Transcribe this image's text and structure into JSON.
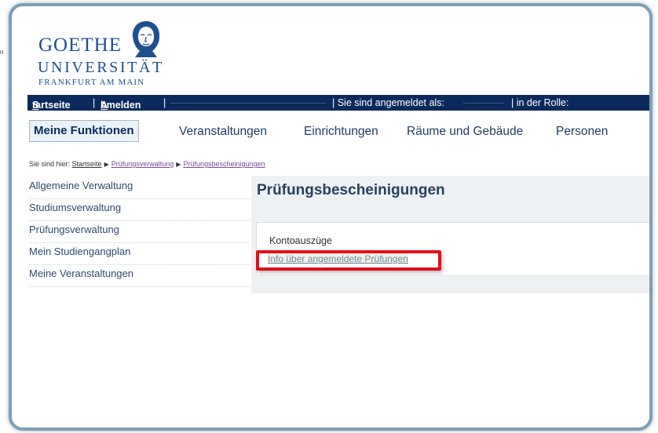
{
  "sidemark": "n",
  "logo": {
    "line1": "GOETHE",
    "line2": "UNIVERSITÄT",
    "line3": "FRANKFURT AM MAIN"
  },
  "topbar": {
    "startseite_S": "S",
    "startseite_rest": "tartseite",
    "sep1": "|",
    "abmelden_A": "A",
    "abmelden_rest": "bmelden",
    "sep2": "|",
    "logged_in": "| Sie sind angemeldet als:",
    "role": "| in der Rolle:"
  },
  "nav": {
    "active": "Meine Funktionen",
    "items": [
      "Veranstaltungen",
      "Einrichtungen",
      "Räume und Gebäude",
      "Personen"
    ]
  },
  "breadcrumb": {
    "prefix": "Sie sind hier:",
    "items": [
      "Startseite",
      "Prüfungsverwaltung",
      "Prüfungsbescheinigungen"
    ]
  },
  "sidebar": {
    "items": [
      "Allgemeine Verwaltung",
      "Studiumsverwaltung",
      "Prüfungsverwaltung",
      "Mein Studiengangplan",
      "Meine Veranstaltungen"
    ]
  },
  "main": {
    "title": "Prüfungsbescheinigungen",
    "link1": "Kontoauszüge",
    "link2": "Info über angemeldete Prüfungen"
  },
  "colors": {
    "topbar": "#0a2a5c",
    "highlight": "#e0101a",
    "brand": "#1f4f8f"
  }
}
